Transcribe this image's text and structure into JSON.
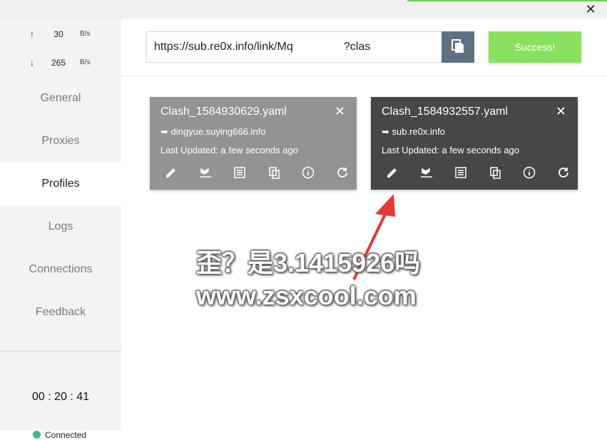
{
  "window": {
    "close_label": "✕"
  },
  "traffic": {
    "up": {
      "arrow": "↑",
      "value": "30",
      "unit": "B/s"
    },
    "down": {
      "arrow": "↓",
      "value": "265",
      "unit": "B/s"
    }
  },
  "sidebar": {
    "items": [
      {
        "label": "General"
      },
      {
        "label": "Proxies"
      },
      {
        "label": "Profiles"
      },
      {
        "label": "Logs"
      },
      {
        "label": "Connections"
      },
      {
        "label": "Feedback"
      }
    ],
    "active": "Profiles",
    "timer": "00 : 20 : 41",
    "status": "Connected",
    "status_color": "#41b883"
  },
  "import": {
    "url_value": "https://sub.re0x.info/link/Mq                ?clas",
    "button_label": "Success!",
    "paste_icon": "paste-icon",
    "button_color": "#8be05f"
  },
  "profiles": [
    {
      "title": "Clash_1584930629.yaml",
      "url": "➥ dingyue.suying666.info",
      "updated": "Last Updated: a few seconds ago",
      "color": "#939393"
    },
    {
      "title": "Clash_1584932557.yaml",
      "url": "➥ sub.re0x.info",
      "updated": "Last Updated: a few seconds ago",
      "color": "#474747"
    }
  ],
  "watermark": {
    "line1": "歪？是3.1415926吗",
    "line2": "www.zsxcool.com"
  }
}
